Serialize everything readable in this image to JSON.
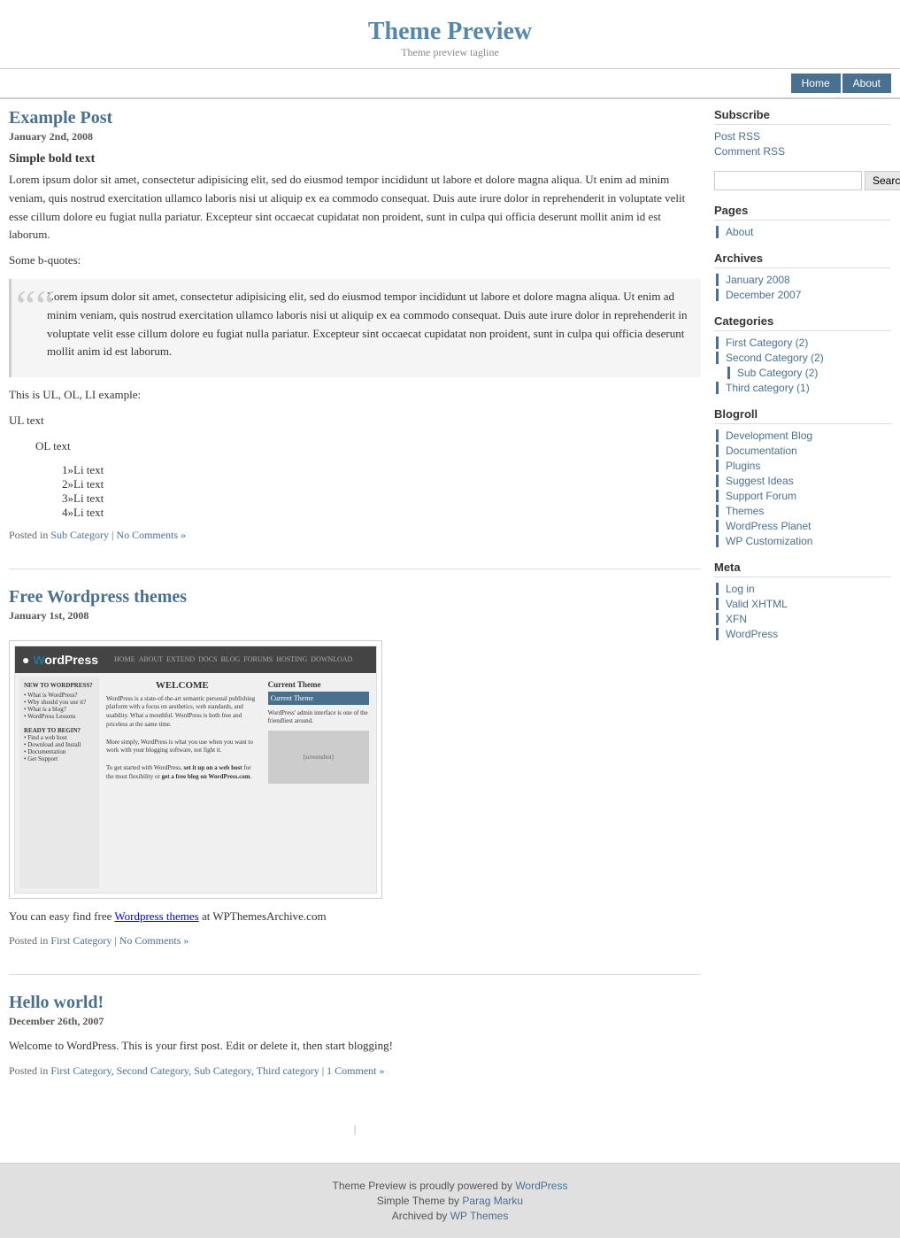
{
  "header": {
    "title": "Theme Preview",
    "tagline": "Theme preview tagline"
  },
  "nav": {
    "items": [
      {
        "label": "Home",
        "href": "#"
      },
      {
        "label": "About",
        "href": "#"
      }
    ]
  },
  "posts": [
    {
      "id": "example-post",
      "title": "Example Post",
      "date": "January 2nd, 2008",
      "bold_heading": "Simple bold text",
      "intro": "Lorem ipsum dolor sit amet, consectetur adipisicing elit, sed do eiusmod tempor incididunt ut labore et dolore magna aliqua. Ut enim ad minim veniam, quis nostrud exercitation ullamco laboris nisi ut aliquip ex ea commodo consequat. Duis aute irure dolor in reprehenderit in voluptate velit esse cillum dolore eu fugiat nulla pariatur. Excepteur sint occaecat cupidatat non proident, sunt in culpa qui officia deserunt mollit anim id est laborum.",
      "bquote_label": "Some b-quotes:",
      "blockquote": "Lorem ipsum dolor sit amet, consectetur adipisicing elit, sed do eiusmod tempor incididunt ut labore et dolore magna aliqua. Ut enim ad minim veniam, quis nostrud exercitation ullamco laboris nisi ut aliquip ex ea commodo consequat. Duis aute irure dolor in reprehenderit in voluptate velit esse cillum dolore eu fugiat nulla pariatur. Excepteur sint occaecat cupidatat non proident, sunt in culpa qui officia deserunt mollit anim id est laborum.",
      "list_label": "This is UL, OL, LI example:",
      "ul_label": "UL text",
      "ol_label": "OL text",
      "li_items": [
        "Li text",
        "Li text",
        "Li text",
        "Li text"
      ],
      "footer_posted": "Posted in",
      "footer_category": "Sub Category",
      "footer_comments": "No Comments »"
    },
    {
      "id": "free-wp-themes",
      "title": "Free Wordpress themes",
      "date": "January 1st, 2008",
      "text1": "You can easy find free",
      "link_text": "Wordpress themes",
      "text2": "at WPThemesArchive.com",
      "footer_posted": "Posted in",
      "footer_category": "First Category",
      "footer_comments": "No Comments »"
    },
    {
      "id": "hello-world",
      "title": "Hello world!",
      "date": "December 26th, 2007",
      "content": "Welcome to WordPress. This is your first post. Edit or delete it, then start blogging!",
      "footer_posted": "Posted in",
      "footer_categories": "First Category, Second Category, Sub Category, Third category",
      "footer_comments": "1 Comment »"
    }
  ],
  "sidebar": {
    "subscribe_heading": "Subscribe",
    "subscribe_items": [
      {
        "label": "Post RSS"
      },
      {
        "label": "Comment RSS"
      }
    ],
    "search_placeholder": "",
    "search_button": "Search",
    "pages_heading": "Pages",
    "pages_items": [
      {
        "label": "About"
      }
    ],
    "archives_heading": "Archives",
    "archives_items": [
      {
        "label": "January 2008"
      },
      {
        "label": "December 2007"
      }
    ],
    "categories_heading": "Categories",
    "categories_items": [
      {
        "label": "First Category (2)"
      },
      {
        "label": "Second Category (2)"
      },
      {
        "label": "Sub Category (2)",
        "indent": true
      },
      {
        "label": "Third category (1)"
      }
    ],
    "blogroll_heading": "Blogroll",
    "blogroll_items": [
      {
        "label": "Development Blog"
      },
      {
        "label": "Documentation"
      },
      {
        "label": "Plugins"
      },
      {
        "label": "Suggest Ideas"
      },
      {
        "label": "Support Forum"
      },
      {
        "label": "Themes"
      },
      {
        "label": "WordPress Planet"
      },
      {
        "label": "WP Customization"
      }
    ],
    "meta_heading": "Meta",
    "meta_items": [
      {
        "label": "Log in"
      },
      {
        "label": "Valid XHTML"
      },
      {
        "label": "XFN"
      },
      {
        "label": "WordPress"
      }
    ]
  },
  "footer": {
    "text1": "Theme Preview is proudly powered by",
    "wordpress_link": "WordPress",
    "text2": "Simple Theme by",
    "parag_link": "Parag Marku",
    "text3": "Archived by",
    "wp_themes_link": "WP Themes"
  }
}
